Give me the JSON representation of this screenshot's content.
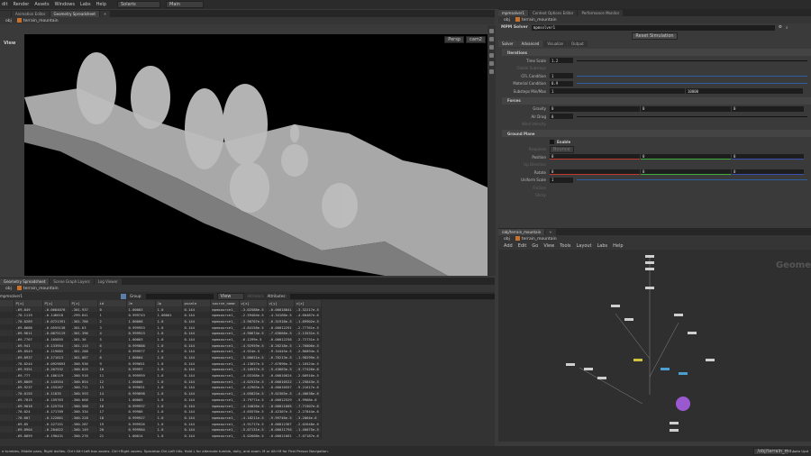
{
  "menu": {
    "items": [
      "dit",
      "Render",
      "Assets",
      "Windows",
      "Labs",
      "Help"
    ],
    "desktop": "Solaris",
    "context": "Main"
  },
  "left_tabs": [
    "Animation Editor",
    "Geometry Spreadsheet"
  ],
  "left_path": {
    "root": "obj",
    "node": "terrain_mountain"
  },
  "viewport": {
    "label": "View",
    "camera": "Persp",
    "cam_menu": "cam2"
  },
  "right_tabs": [
    "mpmsolver1",
    "Context Options Editor",
    "Performance Monitor"
  ],
  "right_path": {
    "root": "obj",
    "node": "terrain_mountain"
  },
  "solver": {
    "type": "MPM Solver",
    "name": "mpmsolver1",
    "reset_label": "Reset Simulation",
    "tabs": [
      "Solver",
      "Advanced",
      "Visualize",
      "Output"
    ],
    "iterations": {
      "title": "Iterations",
      "time_scale_label": "Time Scale",
      "time_scale": "1.2",
      "global_substeps_label": "Global Substeps",
      "cfl_label": "CFL Condition",
      "cfl": "1",
      "material_label": "Material Condition",
      "material": "0.9",
      "substeps_label": "Substeps Min/Max",
      "substeps_min": "1",
      "substeps_max": "10000"
    },
    "forces": {
      "title": "Forces",
      "gravity_label": "Gravity",
      "gravity": [
        "0",
        "0",
        "0"
      ],
      "air_drag_label": "Air Drag",
      "air_drag": "0",
      "wind_label": "Wind Velocity"
    },
    "ground": {
      "title": "Ground Plane",
      "enable_label": "Enable",
      "response_label": "Response",
      "response": "Bounce",
      "position_label": "Position",
      "position": [
        "0",
        "0",
        "0"
      ],
      "up_label": "Up Direction",
      "rotate_label": "Rotate",
      "rotate": [
        "0",
        "0",
        "0"
      ],
      "scale_label": "Uniform Scale",
      "scale": "1",
      "friction_label": "Friction",
      "sticky_label": "Sticky"
    }
  },
  "ne_tabs": [
    "/obj/terrain_mountain"
  ],
  "ne_path": {
    "root": "obj",
    "node": "terrain_mountain"
  },
  "ne_menu": [
    "Add",
    "Edit",
    "Go",
    "View",
    "Tools",
    "Layout",
    "Labs",
    "Help"
  ],
  "ne_watermark": "Geome",
  "bottom_tabs": [
    "Geometry Spreadsheet",
    "Scene Graph Layers",
    "Log Viewer"
  ],
  "bottom_path": {
    "root": "obj",
    "node": "terrain_mountain"
  },
  "spreadsheet": {
    "node": "mpmsolver1",
    "group_label": "Group:",
    "view_label": "View",
    "intrinsics_label": "Intrinsics",
    "attributes_label": "Attributes:",
    "columns": [
      "P[x]",
      "P[y]",
      "P[z]",
      "id",
      "Je",
      "Jp",
      "pscale",
      "source_name",
      "v[x]",
      "v[y]",
      "v[z]"
    ],
    "rows": [
      [
        "-69.849",
        "-0.0684076",
        "-301.937",
        "0",
        "1.00003",
        "1.0",
        "0.144",
        "mpmsource1_",
        "-3.02588e-5",
        "-0.00018841",
        "-3.32217e-5"
      ],
      [
        "-70.1119",
        "-0.146618",
        "-299.641",
        "1",
        "0.999743",
        "1.00001",
        "0.144",
        "mpmsource1_",
        "-2.59404e-5",
        "-4.34168e-5",
        "-4.60487e-6"
      ],
      [
        "-70.0289",
        "-0.0721391",
        "-301.786",
        "2",
        "1.00008",
        "1.0",
        "0.144",
        "mpmsource1_",
        "-3.90707e-5",
        "-6.31918e-5",
        "-1.89902e-5"
      ],
      [
        "-69.8688",
        "-0.0559138",
        "-301.63",
        "3",
        "0.999953",
        "1.0",
        "0.144",
        "mpmsource1_",
        "-4.84158e-5",
        "-0.00012291",
        "-2.77761e-5"
      ],
      [
        "-69.9611",
        "-0.0875119",
        "-301.396",
        "4",
        "0.999923",
        "1.0",
        "0.144",
        "mpmsource1_",
        "-4.90674e-5",
        "-7.03666e-5",
        "-2.13531e-5"
      ],
      [
        "-69.7767",
        "-0.105855",
        "-301.36",
        "5",
        "1.00003",
        "1.0",
        "0.144",
        "mpmsource1_",
        "-6.1299e-5",
        "-0.00012258",
        "-2.72731e-5"
      ],
      [
        "-69.941",
        "-0.133954",
        "-301.115",
        "6",
        "0.999888",
        "1.0",
        "0.144",
        "mpmsource1_",
        "-4.92959e-5",
        "-8.20218e-5",
        "-1.76806e-5"
      ],
      [
        "-69.8543",
        "-0.119883",
        "-301.288",
        "7",
        "0.999977",
        "1.0",
        "0.144",
        "mpmsource1_",
        "-4.924e-5",
        "-9.34445e-5",
        "-2.86894e-5"
      ],
      [
        "-69.8937",
        "-0.171613",
        "-301.087",
        "8",
        "1.00004",
        "1.0",
        "0.144",
        "mpmsource1_",
        "-5.06651e-5",
        "-6.76213e-5",
        "-1.98299e-5"
      ],
      [
        "-70.0244",
        "-0.0929893",
        "-300.936",
        "9",
        "0.999651",
        "1.0",
        "0.144",
        "mpmsource1_",
        "-4.13657e-5",
        "-7.67896e-5",
        "-1.16524e-5"
      ],
      [
        "-69.9351",
        "-0.207532",
        "-300.825",
        "10",
        "0.99997",
        "1.0",
        "0.144",
        "mpmsource1_",
        "-3.10537e-5",
        "-5.43663e-5",
        "-5.77426e-6"
      ],
      [
        "-69.777",
        "-0.186119",
        "-300.916",
        "11",
        "0.999959",
        "1.0",
        "0.144",
        "mpmsource1_",
        "-4.03168e-5",
        "-0.00010624",
        "-2.00916e-5"
      ],
      [
        "-69.8809",
        "-0.143554",
        "-300.854",
        "12",
        "1.00006",
        "1.0",
        "0.144",
        "mpmsource1_",
        "-4.02515e-5",
        "-0.00010522",
        "-1.25843e-5"
      ],
      [
        "-69.9237",
        "-0.155267",
        "-300.711",
        "13",
        "0.999651",
        "1.0",
        "0.144",
        "mpmsource1_",
        "-4.42965e-5",
        "-0.00010557",
        "-9.21617e-6"
      ],
      [
        "-70.0155",
        "-0.11835",
        "-300.593",
        "14",
        "0.999898",
        "1.0",
        "0.144",
        "mpmsource1_",
        "-4.05825e-5",
        "-9.02365e-5",
        "-4.40638e-6"
      ],
      [
        "-69.7815",
        "-0.159763",
        "-300.668",
        "15",
        "1.00005",
        "1.0",
        "0.144",
        "mpmsource1_",
        "-3.79771e-5",
        "-0.00012529",
        "-5.9968e-6"
      ],
      [
        "-69.9018",
        "-0.125754",
        "-300.588",
        "16",
        "0.999937",
        "1.0",
        "0.144",
        "mpmsource1_",
        "-4.34026e-5",
        "-0.00011005",
        "-7.71507e-6"
      ],
      [
        "-70.024",
        "-0.171709",
        "-300.334",
        "17",
        "0.99986",
        "1.0",
        "0.144",
        "mpmsource1_",
        "-4.65576e-5",
        "-8.42307e-5",
        "-2.27844e-6"
      ],
      [
        "-70.007",
        "-0.122861",
        "-300.228",
        "18",
        "0.999927",
        "1.0",
        "0.144",
        "mpmsource1_",
        "-4.18211e-5",
        "-9.99746e-5",
        "-3.2064e-6"
      ],
      [
        "-69.85",
        "-0.227151",
        "-300.287",
        "19",
        "0.999926",
        "1.0",
        "0.144",
        "mpmsource1_",
        "-4.91717e-5",
        "-0.00012367",
        "-2.02648e-6"
      ],
      [
        "-69.8904",
        "-0.204022",
        "-300.149",
        "20",
        "0.999984",
        "1.0",
        "0.144",
        "mpmsource1_",
        "-5.07131e-5",
        "-0.00011794",
        "-1.40075e-5"
      ],
      [
        "-69.8859",
        "-0.190431",
        "-300.276",
        "21",
        "1.00014",
        "1.0",
        "0.144",
        "mpmsource1_",
        "-5.02608e-5",
        "-0.00011661",
        "-7.07187e-6"
      ]
    ]
  },
  "status": {
    "hint": "e tumbles, Middle pans, Right dollies. Ctrl+Alt+Left box zooms. Ctrl+Right zooms. Spacebar-Ctrl-Left tilts. Hold L for alternate tumble, dolly, and zoom. M or Alt+M for First Person Navigation.",
    "path": "/obj/terrain_mo...",
    "update": "Auto Upd"
  },
  "colors": {
    "accent": "#2d5ea0",
    "x_axis": "#c0392b",
    "y_axis": "#3fae3f",
    "z_axis": "#3a4fb0",
    "node_orange": "#c9702a"
  }
}
